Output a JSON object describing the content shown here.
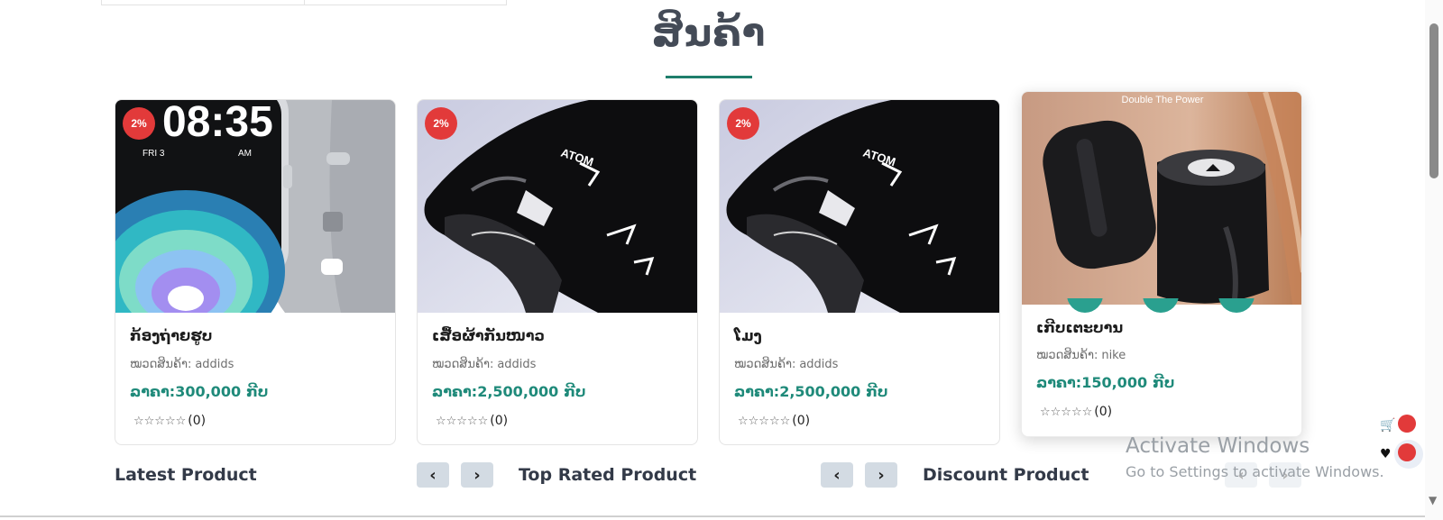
{
  "section": {
    "title": "ສິນຄ້າ"
  },
  "labels": {
    "category": "ໝວດສິນຄ້າ:",
    "price": "ລາຄາ:",
    "currency": "ກີບ"
  },
  "products": [
    {
      "discount": "2%",
      "name": "ກ້ອງຖ່າຍຮູບ",
      "category": "addids",
      "price": "300,000",
      "rating_stars": "☆☆☆☆☆",
      "rating_count": "(0)",
      "image": "smartwatch"
    },
    {
      "discount": "2%",
      "name": "ເສື້ອຜ້າກັນໜາວ",
      "category": "addids",
      "price": "2,500,000",
      "rating_stars": "☆☆☆☆☆",
      "rating_count": "(0)",
      "image": "sneaker"
    },
    {
      "discount": "2%",
      "name": "ໂມງ",
      "category": "addids",
      "price": "2,500,000",
      "rating_stars": "☆☆☆☆☆",
      "rating_count": "(0)",
      "image": "sneaker"
    },
    {
      "name": "ເກີບເຕະບານ",
      "category": "nike",
      "price": "150,000",
      "rating_stars": "☆☆☆☆☆",
      "rating_count": "(0)",
      "image": "speakers",
      "image_caption": "Double The Power"
    }
  ],
  "watch_face_time": "08:35",
  "watch_face_day": "FRI 3",
  "watch_face_ampm": "AM",
  "shoe_brand": "ATOM",
  "footer": {
    "latest": "Latest Product",
    "top_rated": "Top Rated Product",
    "discount": "Discount Product",
    "prev_icon": "chevron-left-icon",
    "next_icon": "chevron-right-icon"
  },
  "floating": {
    "cart_icon": "cart-icon",
    "wishlist_icon": "heart-icon"
  },
  "watermark": {
    "line1": "Activate Windows",
    "line2": "Go to Settings to activate Windows."
  },
  "colors": {
    "accent": "#1f8a7a",
    "badge": "#e23a3a",
    "title": "#444b57",
    "button_bg": "#d3dbe3"
  }
}
